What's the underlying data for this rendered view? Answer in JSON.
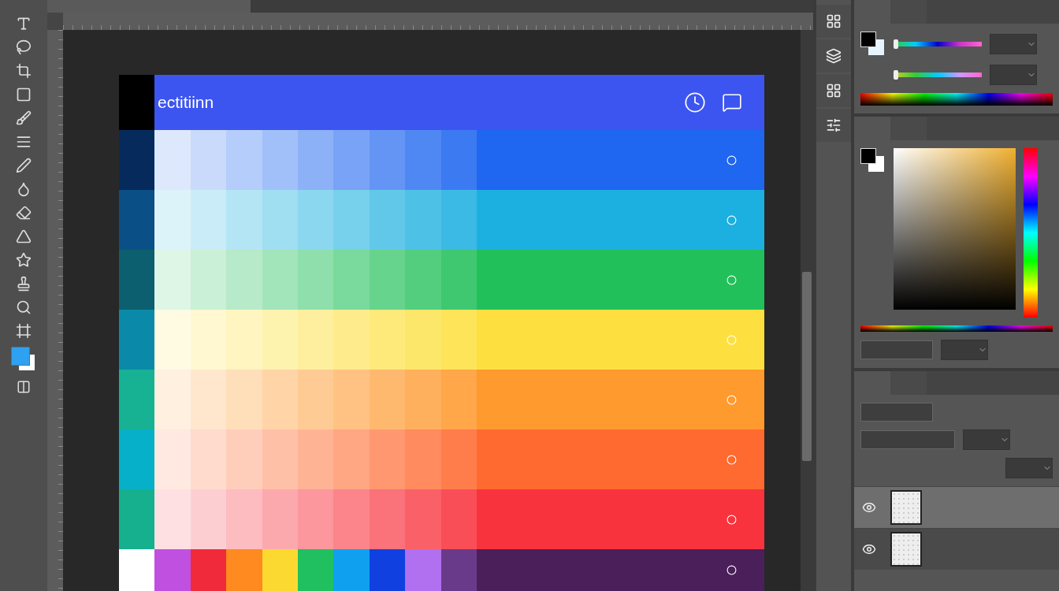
{
  "artboard": {
    "title": "ectitiinn",
    "rows": [
      {
        "color": "#1f66f0"
      },
      {
        "color": "#1cb0e0"
      },
      {
        "color": "#22c05a"
      },
      {
        "color": "#fde040"
      },
      {
        "color": "#ff9a2e"
      },
      {
        "color": "#ff6a30"
      },
      {
        "color": "#f8333e"
      }
    ],
    "swatches": [
      {
        "color": "#ffffff"
      },
      {
        "color": "#c050e0"
      },
      {
        "color": "#f02a3a"
      },
      {
        "color": "#ff8a20"
      },
      {
        "color": "#fcd930"
      },
      {
        "color": "#20c060"
      },
      {
        "color": "#10a0f0"
      },
      {
        "color": "#1040e0"
      },
      {
        "color": "#b070f0"
      },
      {
        "color": "#6a3a8a"
      },
      {
        "color": "#4a1f5a"
      }
    ]
  },
  "color_sliders": [
    {
      "level": 0
    },
    {
      "level": 0
    }
  ],
  "layers": [
    {
      "visible": true,
      "selected": true
    },
    {
      "visible": true,
      "selected": false
    }
  ]
}
